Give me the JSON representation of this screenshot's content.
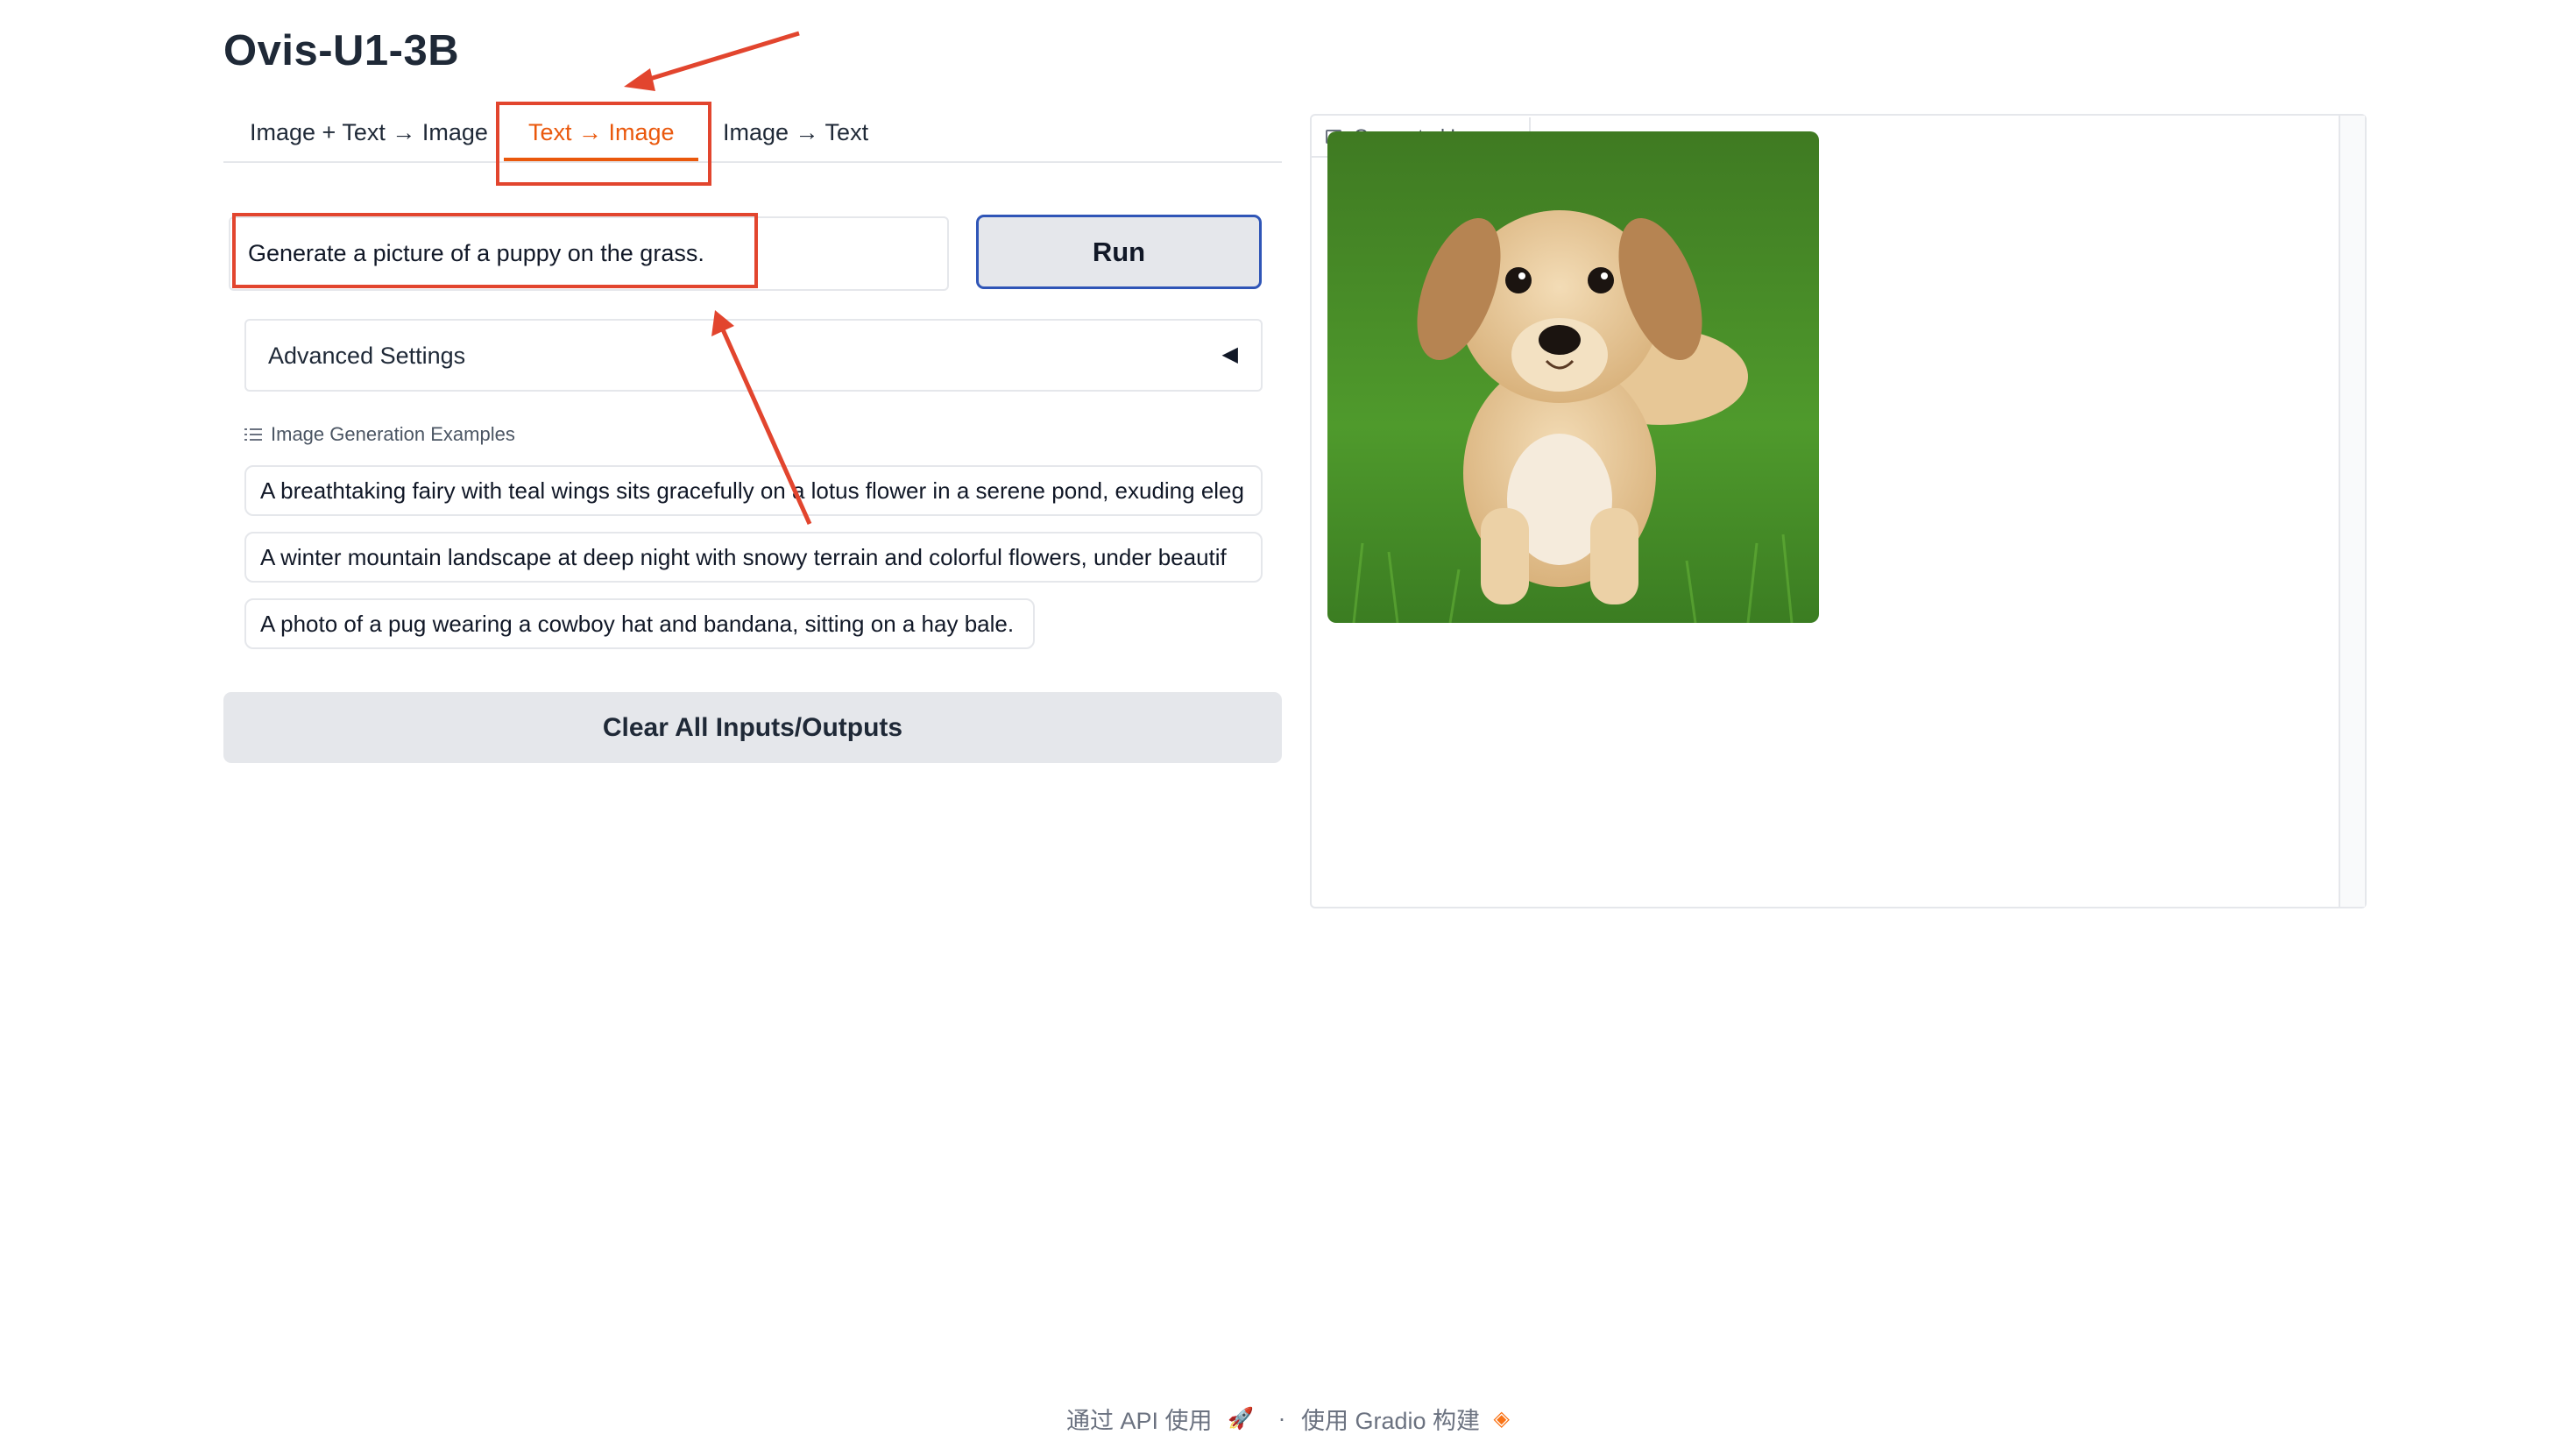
{
  "app": {
    "title": "Ovis-U1-3B"
  },
  "tabs": [
    {
      "label": "Image + Text → Image"
    },
    {
      "label": "Text → Image"
    },
    {
      "label": "Image → Text"
    }
  ],
  "prompt": {
    "value": "Generate a picture of a puppy on the grass."
  },
  "run_button": {
    "label": "Run"
  },
  "advanced_settings": {
    "label": "Advanced Settings",
    "caret": "◀"
  },
  "examples": {
    "label": "Image Generation Examples",
    "items": [
      "A breathtaking fairy with teal wings sits gracefully on a lotus flower in a serene pond, exuding eleg",
      "A winter mountain landscape at deep night with snowy terrain and colorful flowers, under beautif",
      "A photo of a pug wearing a cowboy hat and bandana, sitting on a hay bale."
    ]
  },
  "clear_button": {
    "label": "Clear All Inputs/Outputs"
  },
  "gallery": {
    "label": "Generated Images",
    "icon": "image-icon"
  },
  "footer": {
    "api_text": "通过 API 使用",
    "separator": "·",
    "built_text": "使用 Gradio 构建"
  },
  "colors": {
    "accent": "#ea580c",
    "annotation": "#e2452e",
    "run_border": "#2f55b7"
  }
}
